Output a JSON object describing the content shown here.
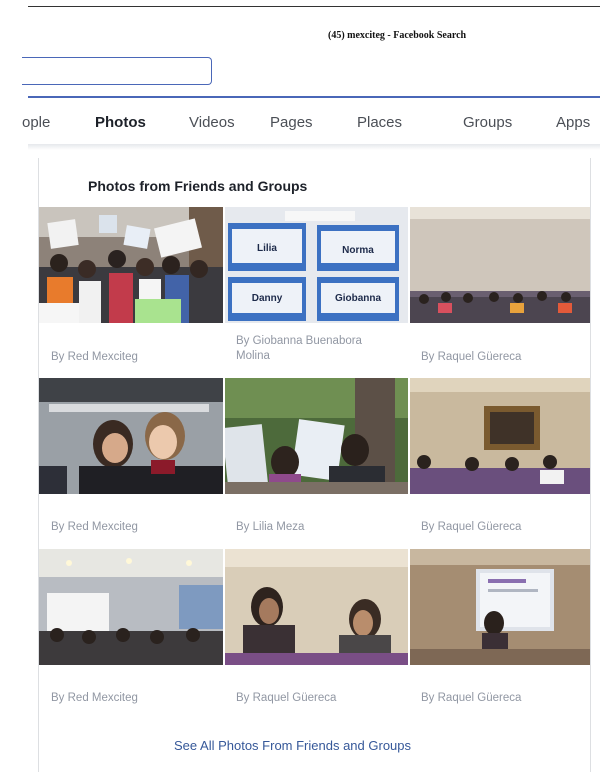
{
  "window": {
    "title": "(45) mexciteg - Facebook Search"
  },
  "search": {
    "value": ""
  },
  "tabs": [
    {
      "label": "ople"
    },
    {
      "label": "Photos"
    },
    {
      "label": "Videos"
    },
    {
      "label": "Pages"
    },
    {
      "label": "Places"
    },
    {
      "label": "Groups"
    },
    {
      "label": "Apps"
    }
  ],
  "active_tab": "Photos",
  "section": {
    "title": "Photos from Friends and Groups",
    "photos": [
      {
        "byline": "By Red Mexciteg"
      },
      {
        "byline": "By Giobanna Buenabora Molina"
      },
      {
        "byline": "By Raquel Güereca"
      },
      {
        "byline": "By Red Mexciteg"
      },
      {
        "byline": "By Lilia Meza"
      },
      {
        "byline": "By Raquel Güereca"
      },
      {
        "byline": "By Red Mexciteg"
      },
      {
        "byline": "By Raquel Güereca"
      },
      {
        "byline": "By Raquel Güereca"
      }
    ],
    "badges": {
      "lilia": "Lilia",
      "norma": "Norma",
      "danny": "Danny",
      "giobanna": "Giobanna"
    },
    "see_all": "See All Photos From Friends and Groups"
  },
  "colors": {
    "link": "#365899",
    "accent": "#4a67b8",
    "byline": "#9197a3"
  }
}
